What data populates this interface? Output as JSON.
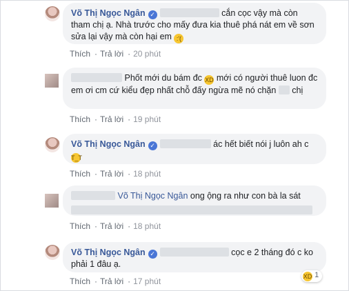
{
  "comments": [
    {
      "author": "Võ Thị Ngọc Ngân",
      "line1": "cắn cọc vậy mà còn tham",
      "line1_rest": "chị ạ. Nhà trước cho mấy đưa kia thuê phá nát em về sơn",
      "line2": "sửa lại vậy mà còn hại em",
      "emoji": "sad-face",
      "like": "Thích",
      "reply": "Trả lời",
      "time": "20 phút"
    },
    {
      "line1": "Phốt mới du bám đc",
      "line1_b": "mới có người thuê luon",
      "line2": "đc em ơi cm cứ kiểu đẹp nhất chỗ đấy ngừa mẽ nó chặn",
      "line3": "chị",
      "emoji": "laughing-face",
      "like": "Thích",
      "reply": "Trả lời",
      "time": "19 phút"
    },
    {
      "author": "Võ Thị Ngọc Ngân",
      "line1": "ác hết biết nói j luôn ah c",
      "emoji": "crying-face",
      "like": "Thích",
      "reply": "Trả lời",
      "time": "18 phút"
    },
    {
      "tag": "Võ Thị Ngọc Ngân",
      "line1": "ong ộng ra như con bà la sát",
      "like": "Thích",
      "reply": "Trả lời",
      "time": "18 phút"
    },
    {
      "author": "Võ Thị Ngọc Ngân",
      "line1": "cọc e 2 tháng đó c ko",
      "line2": "phải 1 đâu ạ.",
      "like": "Thích",
      "reply": "Trả lời",
      "time": "17 phút",
      "reaction_count": "1",
      "reaction": "haha"
    }
  ]
}
